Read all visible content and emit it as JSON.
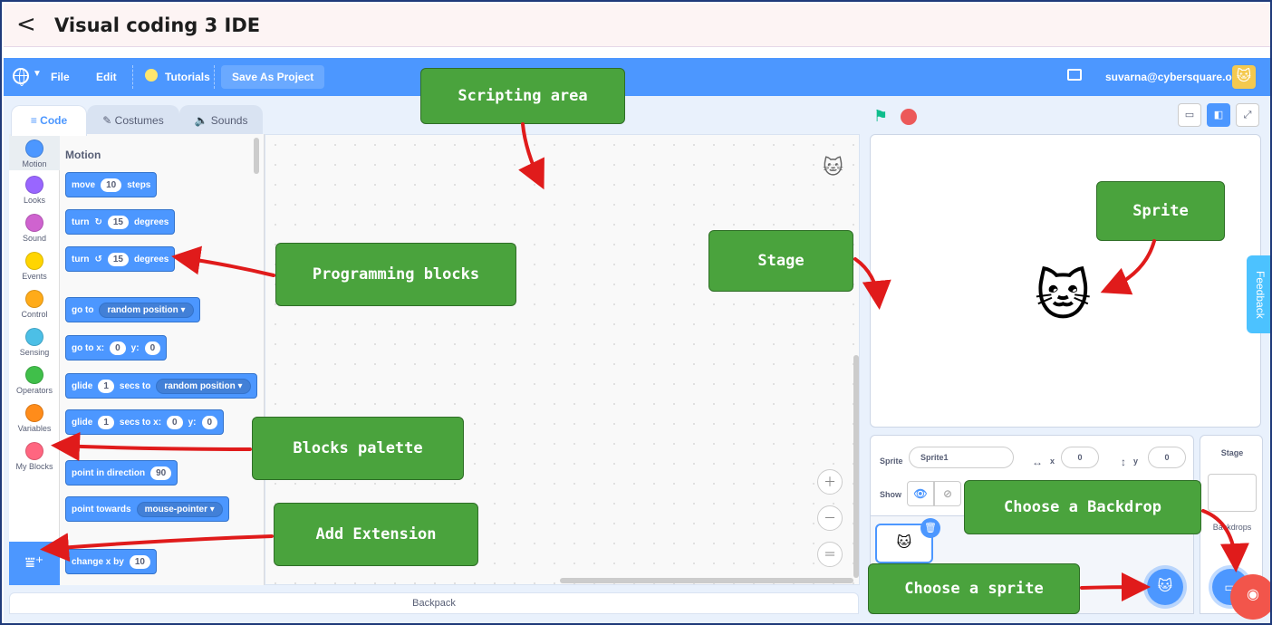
{
  "app": {
    "back_icon": "chevron-left-icon",
    "title": "Visual coding 3 IDE"
  },
  "menubar": {
    "file": "File",
    "edit": "Edit",
    "tutorials": "Tutorials",
    "save_as_project": "Save As Project",
    "user_email": "suvarna@cybersquare.org"
  },
  "tabs": [
    {
      "label": "Code"
    },
    {
      "label": "Costumes"
    },
    {
      "label": "Sounds"
    }
  ],
  "categories": [
    {
      "label": "Motion",
      "color": "#4c97ff"
    },
    {
      "label": "Looks",
      "color": "#9966ff"
    },
    {
      "label": "Sound",
      "color": "#cf63cf"
    },
    {
      "label": "Events",
      "color": "#ffd500"
    },
    {
      "label": "Control",
      "color": "#ffab19"
    },
    {
      "label": "Sensing",
      "color": "#4cbfe6"
    },
    {
      "label": "Operators",
      "color": "#40bf4a"
    },
    {
      "label": "Variables",
      "color": "#ff8c1a"
    },
    {
      "label": "My Blocks",
      "color": "#ff6680"
    }
  ],
  "palette": {
    "section_title": "Motion",
    "blocks": {
      "move": {
        "a": "move",
        "v1": "10",
        "b": "steps"
      },
      "turn_right": {
        "a": "turn",
        "icon": "↻",
        "v1": "15",
        "b": "degrees"
      },
      "turn_left": {
        "a": "turn",
        "icon": "↺",
        "v1": "15",
        "b": "degrees"
      },
      "goto": {
        "a": "go to",
        "dd": "random position ▾"
      },
      "goto_xy": {
        "a": "go to x:",
        "v1": "0",
        "b": "y:",
        "v2": "0"
      },
      "glide": {
        "a": "glide",
        "v1": "1",
        "b": "secs to",
        "dd": "random position ▾"
      },
      "glide_xy": {
        "a": "glide",
        "v1": "1",
        "b": "secs to x:",
        "v2": "0",
        "c": "y:",
        "v3": "0"
      },
      "point_dir": {
        "a": "point in direction",
        "v1": "90"
      },
      "point_towards": {
        "a": "point towards",
        "dd": "mouse-pointer ▾"
      },
      "change_x": {
        "a": "change x by",
        "v1": "10"
      }
    }
  },
  "backpack": "Backpack",
  "sprite_info": {
    "sprite_label": "Sprite",
    "sprite_name": "Sprite1",
    "x_label": "x",
    "x_value": "0",
    "y_label": "y",
    "y_value": "0",
    "show_label": "Show"
  },
  "stage_panel": {
    "title": "Stage",
    "backdrops_label": "Backdrops"
  },
  "feedback": "Feedback",
  "callouts": {
    "scripting_area": "Scripting area",
    "programming_blocks": "Programming blocks",
    "stage": "Stage",
    "sprite": "Sprite",
    "blocks_palette": "Blocks palette",
    "add_extension": "Add Extension",
    "choose_backdrop": "Choose a Backdrop",
    "choose_sprite": "Choose a sprite"
  }
}
